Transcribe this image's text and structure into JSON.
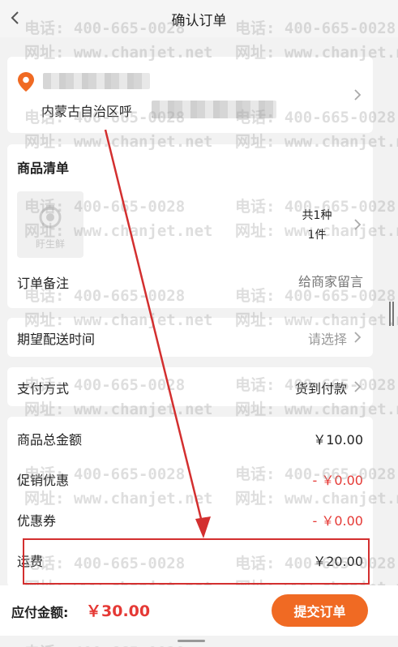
{
  "header": {
    "title": "确认订单"
  },
  "address": {
    "region": "内蒙古自治区呼"
  },
  "goods": {
    "section_title": "商品清单",
    "thumb_text": "盱生鲜",
    "count_kinds": "共1种",
    "count_items": "1件"
  },
  "remark": {
    "label": "订单备注",
    "placeholder": "给商家留言"
  },
  "delivery": {
    "label": "期望配送时间",
    "value": "请选择"
  },
  "payment": {
    "label": "支付方式",
    "value": "货到付款"
  },
  "summary": {
    "total_label": "商品总金额",
    "total_value": "￥10.00",
    "promo_label": "促销优惠",
    "promo_value": "- ￥0.00",
    "coupon_label": "优惠券",
    "coupon_value": "- ￥0.00",
    "shipping_label": "运费",
    "shipping_value": "￥20.00"
  },
  "bottom": {
    "pay_label": "应付金额:",
    "pay_amount": "￥30.00",
    "submit_label": "提交订单"
  },
  "watermark": {
    "phone": "电话: 400-665-0028",
    "site": "网址: www.chanjet.net"
  },
  "colors": {
    "accent": "#f06a23",
    "price_red": "#e53935",
    "annotation_red": "#d32f2f"
  }
}
